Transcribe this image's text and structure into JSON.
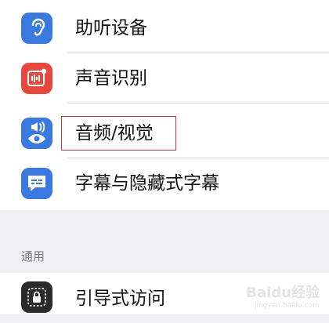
{
  "settings": {
    "items": [
      {
        "label": "助听设备",
        "icon": "ear-icon",
        "icon_color": "#3a7ae0"
      },
      {
        "label": "声音识别",
        "icon": "sound-recognition-icon",
        "icon_color": "#e8483b"
      },
      {
        "label": "音频/视觉",
        "icon": "audio-visual-icon",
        "icon_color": "#3a7ae0"
      },
      {
        "label": "字幕与隐藏式字幕",
        "icon": "subtitles-icon",
        "icon_color": "#3a7ae0"
      }
    ],
    "general_header": "通用",
    "general_items": [
      {
        "label": "引导式访问",
        "icon": "guided-access-icon",
        "icon_color": "#2b2b2b"
      }
    ]
  },
  "watermark": {
    "text": "Baidu经验",
    "url": "jingyan.baidu.com"
  },
  "colors": {
    "highlight_border": "#c9333a",
    "background": "#efeff4"
  }
}
